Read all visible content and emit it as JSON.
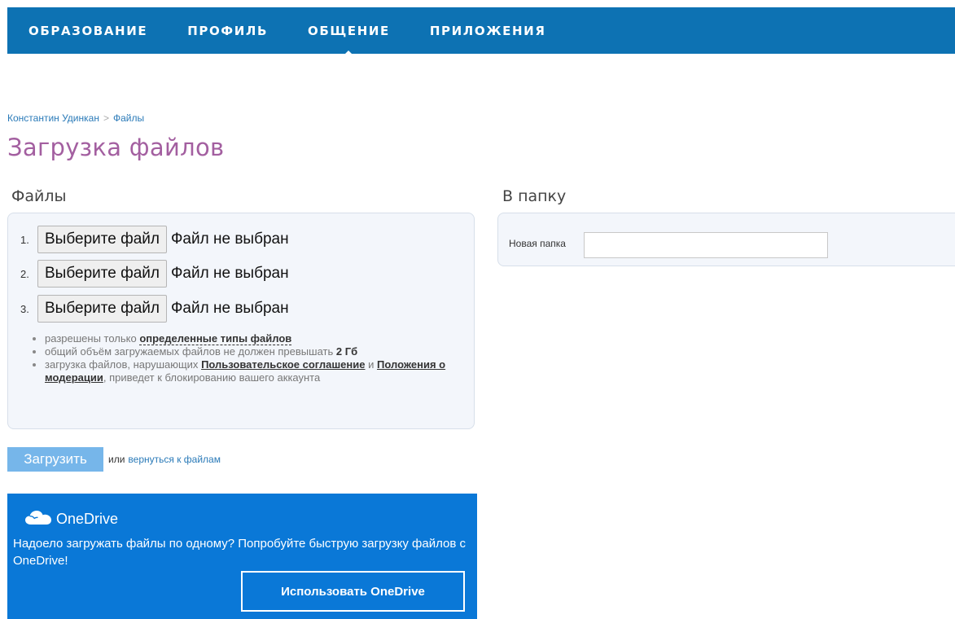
{
  "nav": {
    "items": [
      {
        "label": "ОБРАЗОВАНИЕ"
      },
      {
        "label": "ПРОФИЛЬ"
      },
      {
        "label": "ОБЩЕНИЕ"
      },
      {
        "label": "ПРИЛОЖЕНИЯ"
      }
    ],
    "active_index": 2
  },
  "breadcrumb": {
    "user": "Константин Удинкан",
    "separator": ">",
    "section": "Файлы"
  },
  "page_title": "Загрузка файлов",
  "files": {
    "title": "Файлы",
    "rows": [
      {
        "num": "1.",
        "button": "Выберите файл",
        "status": "Файл не выбран"
      },
      {
        "num": "2.",
        "button": "Выберите файл",
        "status": "Файл не выбран"
      },
      {
        "num": "3.",
        "button": "Выберите файл",
        "status": "Файл не выбран"
      }
    ],
    "rules": {
      "r1_prefix": "разрешены только",
      "r1_link": "определенные типы файлов",
      "r2_prefix": "общий объём загружаемых файлов не должен превышать",
      "r2_value": "2 Гб",
      "r3_prefix": "загрузка файлов, нарушающих",
      "r3_link1": "Пользовательское соглашение",
      "r3_and": "и",
      "r3_link2": "Положения о модерации",
      "r3_suffix": ", приведет к блокированию вашего аккаунта"
    }
  },
  "upload": {
    "button": "Загрузить",
    "or": "или",
    "back_link": "вернуться к файлам"
  },
  "onedrive": {
    "brand": "OneDrive",
    "text": "Надоело загружать файлы по одному? Попробуйте быструю загрузку файлов с OneDrive!",
    "button": "Использовать OneDrive"
  },
  "folder": {
    "title": "В папку",
    "label": "Новая папка",
    "value": "",
    "placeholder": ""
  },
  "colors": {
    "nav_bg": "#0d72b3",
    "title": "#a35fa0",
    "link": "#2a7ab8",
    "upload_btn": "#76b6ea",
    "onedrive_bg": "#0a78d7"
  }
}
